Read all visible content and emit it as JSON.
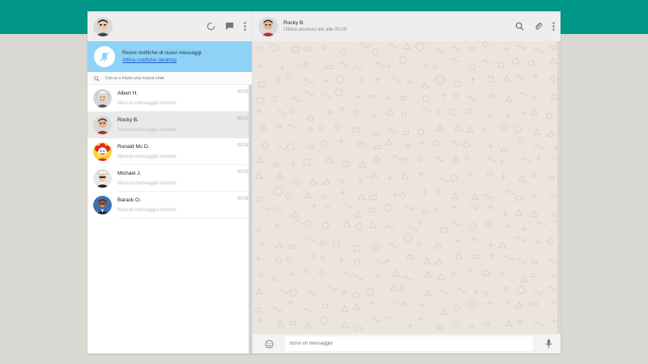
{
  "app": {
    "accent_color": "#009688",
    "background_color": "#dad8d2"
  },
  "sidebar": {
    "header": {
      "avatar": "user-avatar",
      "icons": [
        "status-icon",
        "new-chat-icon",
        "menu-icon"
      ]
    },
    "notification": {
      "title": "Ricevi notifiche di nuovi messaggi",
      "link": "Attiva notifiche desktop",
      "icon": "bell-off-icon",
      "color": "#8ed3f7"
    },
    "search": {
      "placeholder": "Cerca o inizia una nuova chat",
      "icon": "search-icon"
    },
    "chats": [
      {
        "name": "Albert H.",
        "preview": "Nessun messaggio recente",
        "time": "00:00",
        "avatar": "albert-avatar",
        "active": false
      },
      {
        "name": "Rocky B.",
        "preview": "Nessun messaggio recente",
        "time": "00:00",
        "avatar": "rocky-avatar",
        "active": true
      },
      {
        "name": "Ronald Mc D.",
        "preview": "Nessun messaggio recente",
        "time": "00:00",
        "avatar": "ronald-avatar",
        "active": false
      },
      {
        "name": "Michael J.",
        "preview": "Nessun messaggio recente",
        "time": "00:00",
        "avatar": "michael-avatar",
        "active": false
      },
      {
        "name": "Barack O.",
        "preview": "Nessun messaggio recente",
        "time": "00:00",
        "avatar": "barack-avatar",
        "active": false
      }
    ]
  },
  "conversation": {
    "header": {
      "name": "Rocky B.",
      "status": "Ultimo accesso ieri alle 00.00",
      "icons": [
        "search-icon",
        "attach-icon",
        "menu-icon"
      ]
    },
    "wallpaper_color": "#ece5dd",
    "composer": {
      "placeholder": "Scrivi un messaggio",
      "emoji_icon": "emoji-icon",
      "mic_icon": "mic-icon"
    }
  }
}
